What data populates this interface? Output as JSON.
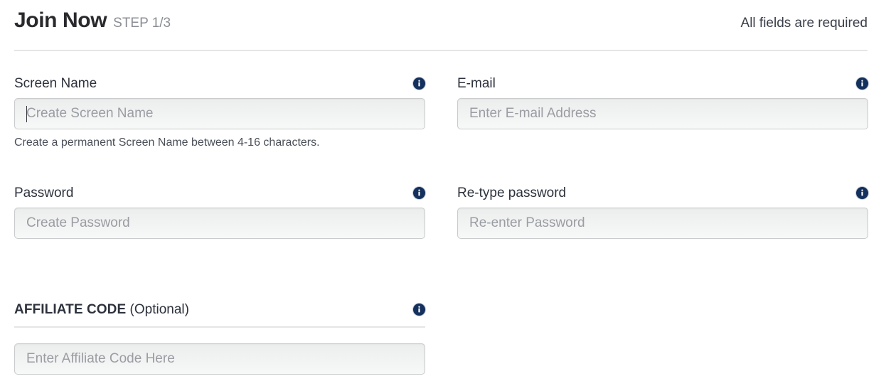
{
  "header": {
    "title": "Join Now",
    "step": "STEP 1/3",
    "required_note": "All fields are required"
  },
  "fields": {
    "screen_name": {
      "label": "Screen Name",
      "placeholder": "Create Screen Name",
      "value": "",
      "helper": "Create a permanent Screen Name between 4-16 characters.",
      "info_icon": "info-icon",
      "focused": true
    },
    "email": {
      "label": "E-mail",
      "placeholder": "Enter E-mail Address",
      "value": "",
      "info_icon": "info-icon"
    },
    "password": {
      "label": "Password",
      "placeholder": "Create Password",
      "value": "",
      "info_icon": "info-icon"
    },
    "retype_password": {
      "label": "Re-type password",
      "placeholder": "Re-enter Password",
      "value": "",
      "info_icon": "info-icon"
    },
    "affiliate_code": {
      "label_strong": "AFFILIATE CODE",
      "label_optional": " (Optional)",
      "placeholder": "Enter Affiliate Code Here",
      "value": "",
      "info_icon": "info-icon"
    }
  },
  "colors": {
    "info_icon_bg": "#14305c",
    "title": "#2a2a2e",
    "step": "#8a8d93",
    "rule": "#e4e5e7",
    "input_border": "#c9cbcc",
    "placeholder": "#9a9da2"
  }
}
